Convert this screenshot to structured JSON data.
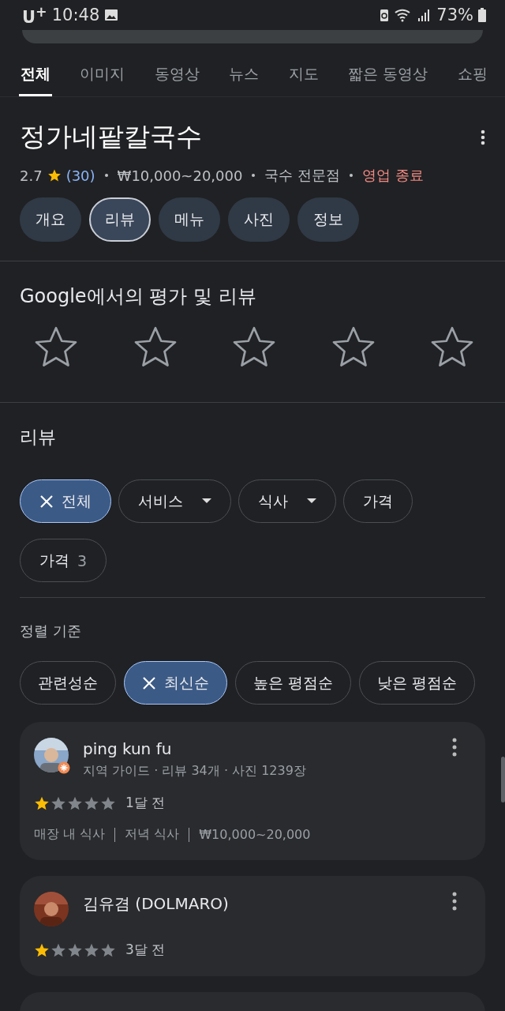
{
  "status_bar": {
    "carrier": "U$^{+}$",
    "time": "10:48",
    "battery": "73%"
  },
  "search_tabs": [
    {
      "label": "전체",
      "selected": true
    },
    {
      "label": "이미지",
      "selected": false
    },
    {
      "label": "동영상",
      "selected": false
    },
    {
      "label": "뉴스",
      "selected": false
    },
    {
      "label": "지도",
      "selected": false
    },
    {
      "label": "짧은 동영상",
      "selected": false
    },
    {
      "label": "쇼핑",
      "selected": false
    }
  ],
  "place": {
    "title": "정가네팥칼국수",
    "rating": "2.7",
    "review_count": "(30)",
    "price": "₩10,000~20,000",
    "category": "국수 전문점",
    "status": "영업 종료",
    "section_tabs": [
      {
        "label": "개요",
        "selected": false
      },
      {
        "label": "리뷰",
        "selected": true
      },
      {
        "label": "메뉴",
        "selected": false
      },
      {
        "label": "사진",
        "selected": false
      },
      {
        "label": "정보",
        "selected": false
      }
    ]
  },
  "rate_section": {
    "heading": "Google에서의 평가 및 리뷰",
    "stars": 0
  },
  "reviews": {
    "heading": "리뷰",
    "filters": [
      {
        "label": "전체",
        "kind": "plain",
        "selected": true
      },
      {
        "label": "서비스",
        "kind": "dropdown",
        "selected": false
      },
      {
        "label": "식사",
        "kind": "dropdown",
        "selected": false
      },
      {
        "label": "가격",
        "kind": "plain",
        "selected": false
      },
      {
        "label": "가격",
        "count": "3",
        "kind": "plain",
        "selected": false
      }
    ],
    "sort_label": "정렬 기준",
    "sort_options": [
      {
        "label": "관련성순",
        "selected": false
      },
      {
        "label": "최신순",
        "selected": true
      },
      {
        "label": "높은 평점순",
        "selected": false
      },
      {
        "label": "낮은 평점순",
        "selected": false
      }
    ],
    "cards": [
      {
        "name": "ping kun fu",
        "meta": "지역 가이드 · 리뷰 34개 · 사진 1239장",
        "local_guide": true,
        "stars": 1,
        "time": "1달 전",
        "details": [
          "매장 내 식사",
          "저녁 식사",
          "₩10,000~20,000"
        ]
      },
      {
        "name": "김유겸 (DOLMARO)",
        "local_guide": false,
        "stars": 1,
        "time": "3달 전"
      }
    ]
  }
}
